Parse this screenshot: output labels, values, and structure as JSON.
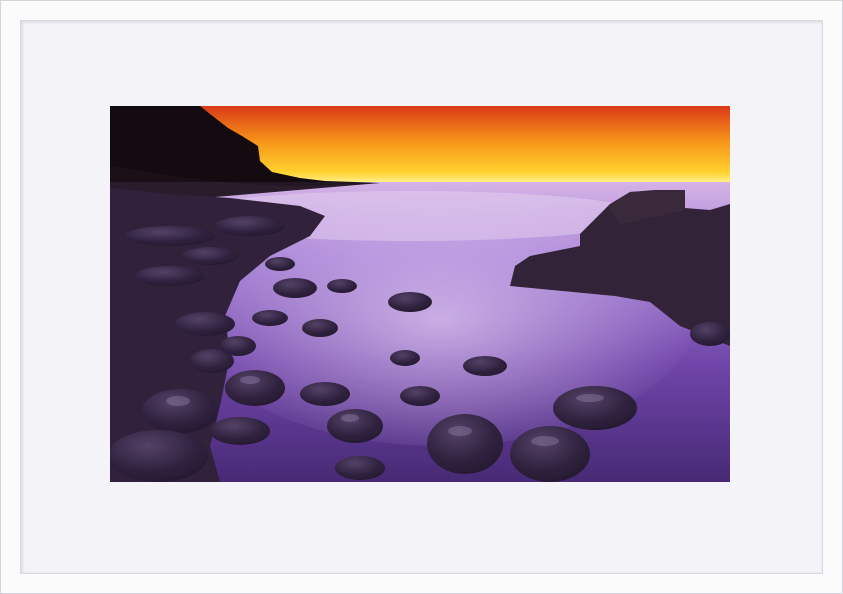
{
  "artwork": {
    "subject": "",
    "colors": {
      "sky_top": "#e0441a",
      "sky_mid": "#f7a11a",
      "sky_horizon": "#fff27a",
      "sea_light": "#c9a7e6",
      "sea_deep": "#4a2a7a",
      "rock": "#1c1224",
      "frame": "#fbfbfc",
      "mat": "#f4f3f7"
    }
  }
}
